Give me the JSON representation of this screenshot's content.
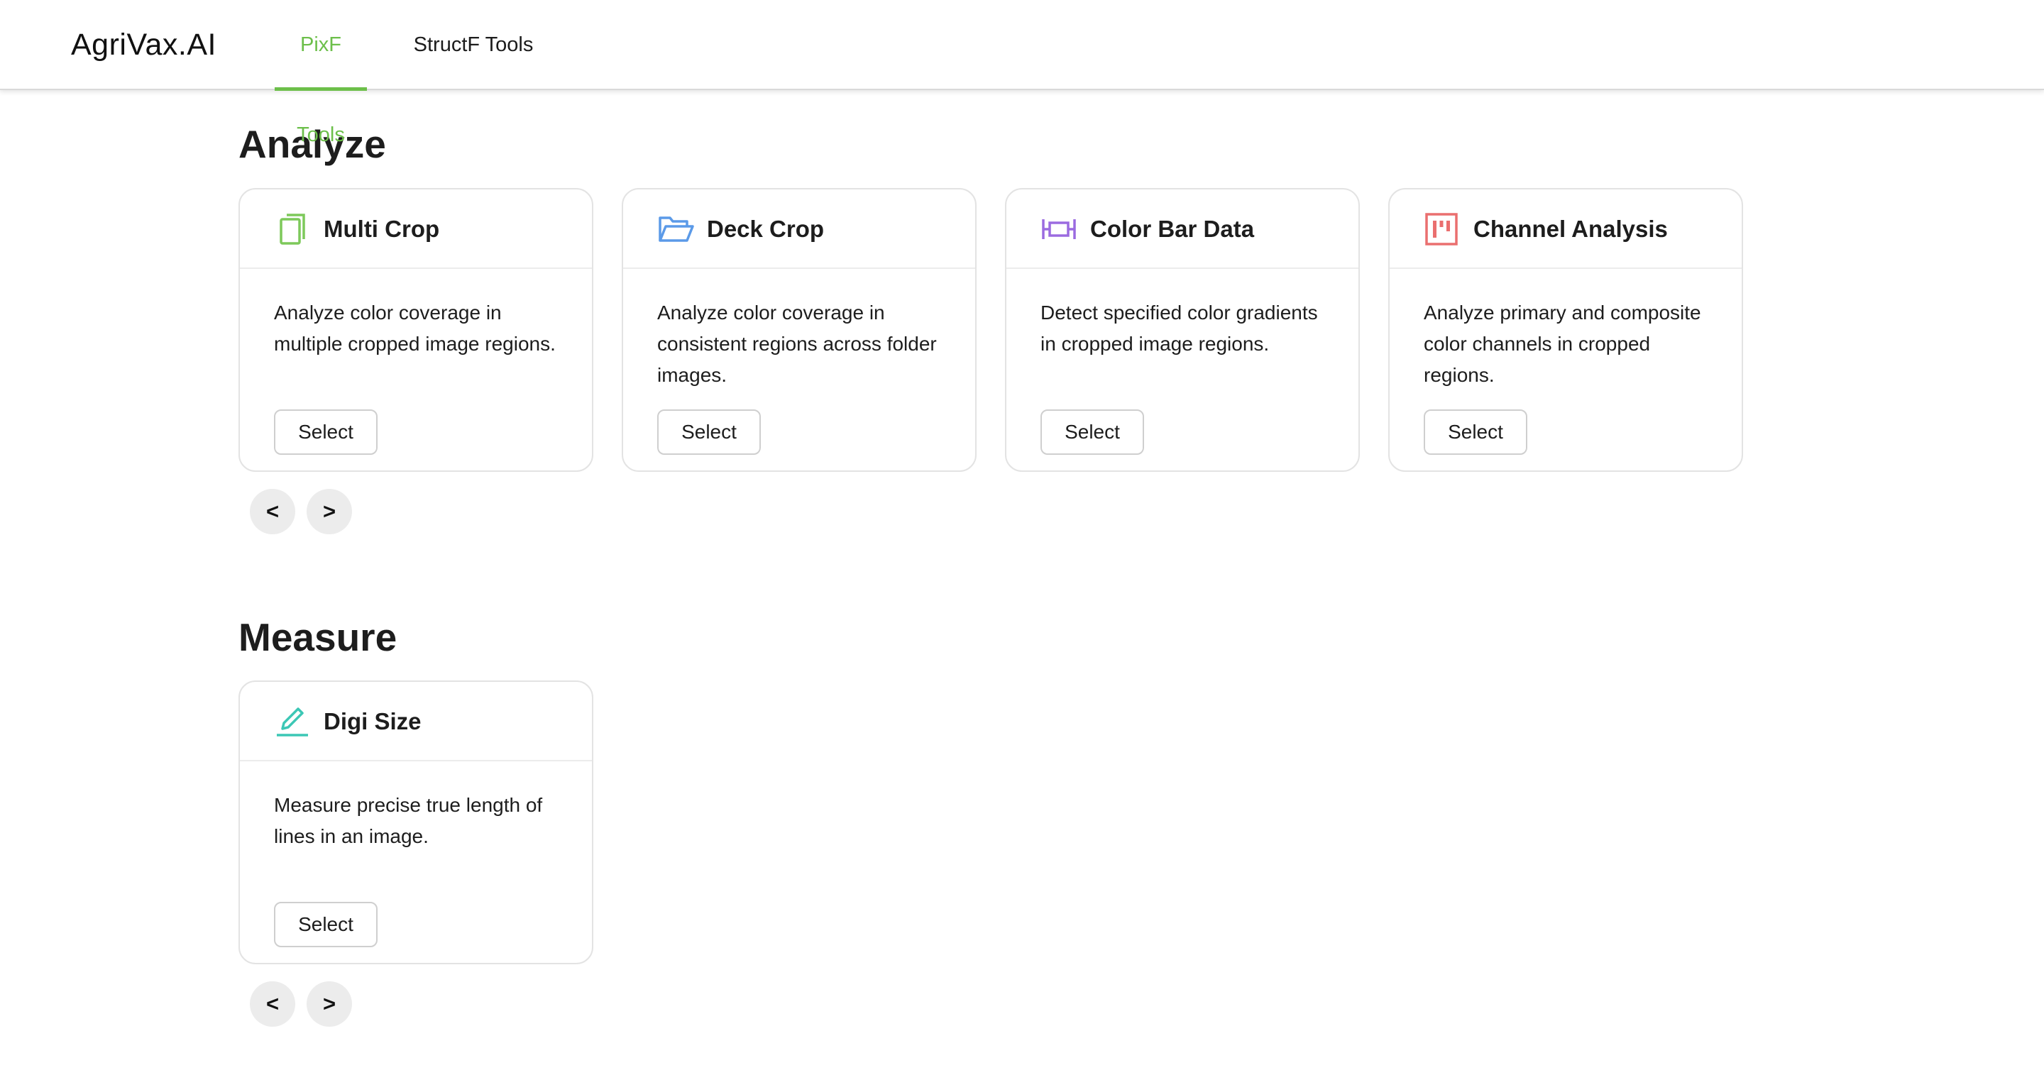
{
  "header": {
    "logo": "AgriVax.AI",
    "tabs": [
      {
        "label": "PixF Tools",
        "active": true
      },
      {
        "label": "StructF Tools",
        "active": false
      }
    ],
    "accent_color": "#6cbf4a"
  },
  "sections": [
    {
      "title": "Analyze",
      "cards": [
        {
          "title": "Multi Crop",
          "icon": "copy-icon",
          "icon_color": "#7dc95a",
          "description": "Analyze color coverage in multiple cropped image regions.",
          "button": "Select"
        },
        {
          "title": "Deck Crop",
          "icon": "folder-open-icon",
          "icon_color": "#5b9ae8",
          "description": "Analyze color coverage in consistent regions across folder images.",
          "button": "Select"
        },
        {
          "title": "Color Bar Data",
          "icon": "column-width-icon",
          "icon_color": "#9b6be0",
          "description": "Detect specified color gradients in cropped image regions.",
          "button": "Select"
        },
        {
          "title": "Channel Analysis",
          "icon": "project-board-icon",
          "icon_color": "#ea6f6f",
          "description": "Analyze primary and composite color channels in cropped regions.",
          "button": "Select"
        }
      ],
      "pager": {
        "prev": "<",
        "next": ">"
      }
    },
    {
      "title": "Measure",
      "cards": [
        {
          "title": "Digi Size",
          "icon": "edit-pen-icon",
          "icon_color": "#3cc7b5",
          "description": "Measure precise true length of lines in an image.",
          "button": "Select"
        }
      ],
      "pager": {
        "prev": "<",
        "next": ">"
      }
    }
  ]
}
